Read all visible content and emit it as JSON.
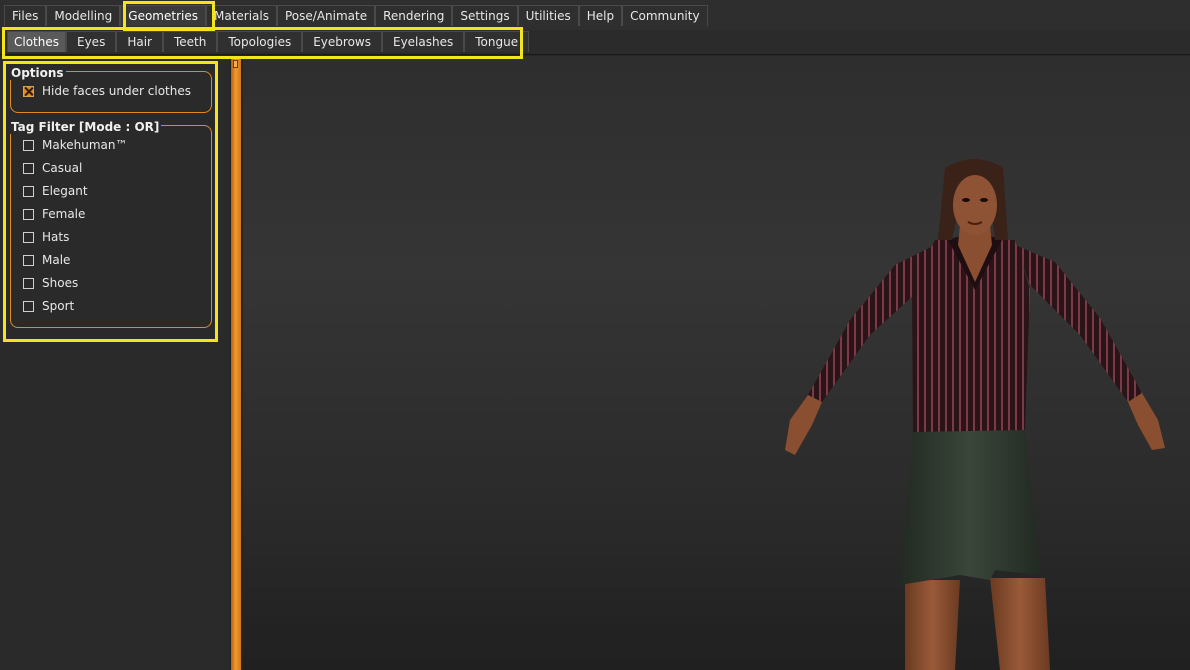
{
  "main_tabs": [
    "Files",
    "Modelling",
    "Geometries",
    "Materials",
    "Pose/Animate",
    "Rendering",
    "Settings",
    "Utilities",
    "Help",
    "Community"
  ],
  "main_tab_active": "Geometries",
  "sub_tabs": [
    "Clothes",
    "Eyes",
    "Hair",
    "Teeth",
    "Topologies",
    "Eyebrows",
    "Eyelashes",
    "Tongue"
  ],
  "sub_tab_active": "Clothes",
  "options": {
    "title": "Options",
    "hide_faces_label": "Hide faces under clothes",
    "hide_faces_checked": true
  },
  "tag_filter": {
    "title": "Tag Filter [Mode : OR]",
    "tags": [
      "Makehuman™",
      "Casual",
      "Elegant",
      "Female",
      "Hats",
      "Male",
      "Shoes",
      "Sport"
    ]
  },
  "colors": {
    "highlight": "#f2e51a",
    "accent_orange": "#e08a1e",
    "background": "#262626"
  },
  "icons": {
    "checkbox_checked": "x-mark-icon",
    "splitter": "splitter-grip-icon"
  }
}
